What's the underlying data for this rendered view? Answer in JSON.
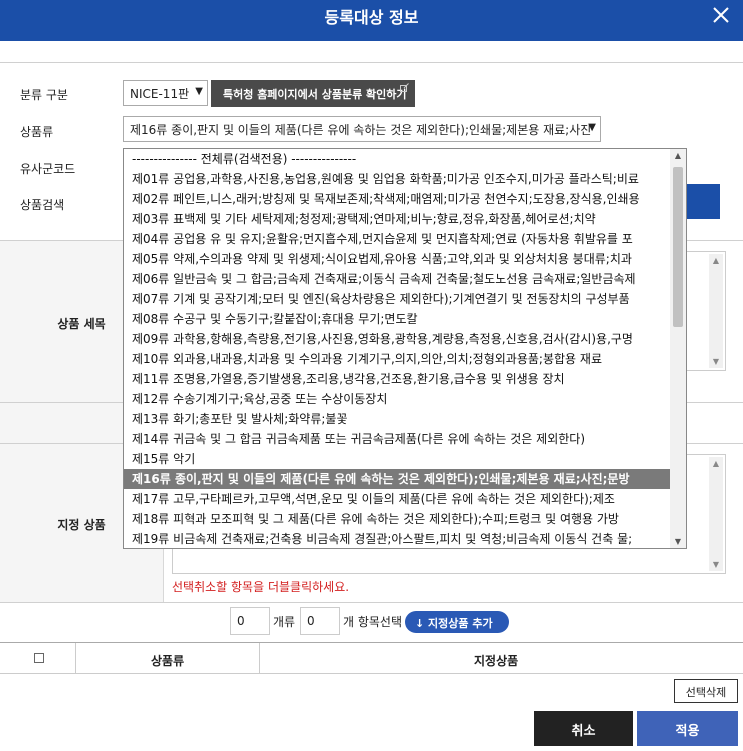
{
  "header": {
    "title": "등록대상 정보"
  },
  "form": {
    "class_label": "분류 구분",
    "class_value": "NICE-11판",
    "patent_button": "특허청 홈페이지에서 상품분류 확인하기",
    "goods_class_label": "상품류",
    "goods_class_value": "제16류 종이,판지 및 이들의 제품(다른 유에 속하는 것은 제외한다);인쇄물;제본용 재료;사진",
    "similar_code_label": "유사군코드",
    "search_label": "상품검색"
  },
  "sections": {
    "goods_detail": "상품 세목",
    "designated_goods": "지정 상품",
    "hint": "선택취소할 항목을 더블클릭하세요."
  },
  "count_row": {
    "count1": "0",
    "unit1": "개류",
    "count2": "0",
    "unit2": "개 항목선택",
    "add_button": "↓  지정상품 추가"
  },
  "table": {
    "col1": "상품류",
    "col2": "지정상품"
  },
  "buttons": {
    "delete": "선택삭제",
    "cancel": "취소",
    "apply": "적용"
  },
  "dropdown": {
    "selected_index": 16,
    "options": [
      "--------------- 전체류(검색전용) ---------------",
      "제01류 공업용,과학용,사진용,농업용,원예용 및 임업용 화학품;미가공 인조수지,미가공 플라스틱;비료",
      "제02류 페인트,니스,래커;방칭제 및 목재보존제;착색제;매염제;미가공 천연수지;도장용,장식용,인쇄용",
      "제03류 표백제 및 기타 세탁제제;청정제;광택제;연마제;비누;향료,정유,화장품,헤어로션;치약",
      "제04류 공업용 유 및 유지;윤활유;먼지흡수제,먼지습윤제 및 먼지흡착제;연료 (자동차용 휘발유를 포",
      "제05류 약제,수의과용 약제 및 위생제;식이요법제,유아용 식품;고약,외과 및 외상처치용 붕대류;치과",
      "제06류 일반금속 및 그 합금;금속제 건축재료;이동식 금속제 건축물;철도노선용 금속재료;일반금속제",
      "제07류 기계 및 공작기계;모터 및 엔진(육상차량용은 제외한다);기계연결기 및 전동장치의 구성부품",
      "제08류 수공구 및 수동기구;칼붙잡이;휴대용 무기;면도칼",
      "제09류 과학용,항해용,측량용,전기용,사진용,영화용,광학용,계량용,측정용,신호용,검사(감시)용,구명",
      "제10류 외과용,내과용,치과용 및 수의과용 기계기구,의지,의안,의치;정형외과용품;봉합용 재료",
      "제11류 조명용,가열용,증기발생용,조리용,냉각용,건조용,환기용,급수용 및 위생용 장치",
      "제12류 수송기계기구;육상,공중 또는 수상이동장치",
      "제13류 화기;총포탄 및 발사체;화약류;불꽃",
      "제14류 귀금속 및 그 합금 귀금속제품 또는 귀금속금제품(다른 유에 속하는 것은 제외한다)",
      "제15류 악기",
      "제16류 종이,판지 및 이들의 제품(다른 유에 속하는 것은 제외한다);인쇄물;제본용 재료;사진;문방",
      "제17류 고무,구타페르카,고무액,석면,운모 및 이들의 제품(다른 유에 속하는 것은 제외한다);제조",
      "제18류 피혁과 모조피혁 및 그 제품(다른 유에 속하는 것은 제외한다);수피;트렁크 및 여행용 가방",
      "제19류 비금속제 건축재료;건축용 비금속제 경질관;아스팔트,피치 및 역청;비금속제 이동식 건축 물;"
    ]
  },
  "colors": {
    "header": "#1b4fa8",
    "hint": "#d32020",
    "apply": "#3f63b8",
    "cancel": "#222222"
  },
  "icons": [
    "close-icon",
    "external-link-icon",
    "chevron-down-icon",
    "arrow-down-icon",
    "scroll-up-icon",
    "scroll-down-icon"
  ]
}
